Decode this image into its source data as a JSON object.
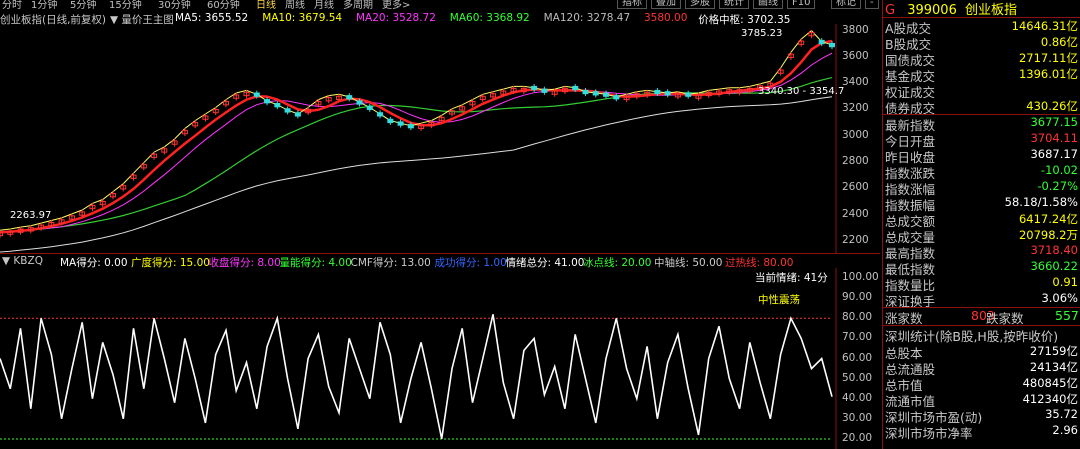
{
  "timeframe_tabs": [
    "分时",
    "1分钟",
    "5分钟",
    "15分钟",
    "30分钟",
    "60分钟",
    "日线",
    "周线",
    "月线",
    "多周期",
    "更多>"
  ],
  "selected_tab": "日线",
  "toolbar_buttons": [
    "指标",
    "叠加",
    "多股",
    "统计",
    "画线",
    "F10",
    "标记",
    "-",
    "回",
    "显"
  ],
  "ma_line": {
    "title": "创业板指(日线,前复权)",
    "subtitle": "▼ 量价王主图",
    "items": [
      {
        "label": "MA5: 3655.52",
        "color": "#ffffff"
      },
      {
        "label": "MA10: 3679.54",
        "color": "#ffff00"
      },
      {
        "label": "MA20: 3528.72",
        "color": "#ff33ff"
      },
      {
        "label": "MA60: 3368.92",
        "color": "#33ff33"
      },
      {
        "label": "MA120: 3278.47",
        "color": "#bbbbbb"
      },
      {
        "label": "3580.00",
        "color": "#ff3333"
      },
      {
        "label": "价格中枢: 3702.35",
        "color": "#ffffff"
      }
    ]
  },
  "price_axis": [
    "3800",
    "3600",
    "3400",
    "3200",
    "3000",
    "2800",
    "2600",
    "2400",
    "2200"
  ],
  "price_annotations": {
    "high": "3785.23",
    "low": "2263.97",
    "mid": "3340.30 - 3354.7"
  },
  "osc_line": {
    "name": "KBZQ",
    "items": [
      {
        "label": "MA得分: 0.00",
        "color": "#ffffff"
      },
      {
        "label": "广度得分: 15.00",
        "color": "#ffff00"
      },
      {
        "label": "收盘得分: 8.00",
        "color": "#ff33ff"
      },
      {
        "label": "量能得分: 4.00",
        "color": "#33ff33"
      },
      {
        "label": "CMF得分: 13.00",
        "color": "#cccccc"
      },
      {
        "label": "成功得分: 1.00",
        "color": "#3366ff"
      },
      {
        "label": "情绪总分: 41.00",
        "color": "#ffffff"
      },
      {
        "label": "冰点线: 20.00",
        "color": "#33ff33"
      },
      {
        "label": "中轴线: 50.00",
        "color": "#cccccc"
      },
      {
        "label": "过热线: 80.00",
        "color": "#ff3333"
      }
    ]
  },
  "osc_axis": [
    "100.00",
    "90.00",
    "80.00",
    "70.00",
    "60.00",
    "50.00",
    "40.00",
    "30.00",
    "20.00"
  ],
  "current_mood_label": "当前情绪: 41分",
  "mood_state": "中性震荡",
  "index_header": {
    "prefix": "G",
    "code": "399006",
    "name": "创业板指"
  },
  "turnover_rows": [
    {
      "k": "A股成交",
      "v": "14646.31亿",
      "c": "#ffff00"
    },
    {
      "k": "B股成交",
      "v": "0.86亿",
      "c": "#ffff00"
    },
    {
      "k": "国债成交",
      "v": "2717.11亿",
      "c": "#ffff00"
    },
    {
      "k": "基金成交",
      "v": "1396.01亿",
      "c": "#ffff00"
    },
    {
      "k": "权证成交",
      "v": "",
      "c": "#ffff00"
    },
    {
      "k": "债券成交",
      "v": "430.26亿",
      "c": "#ffff00"
    }
  ],
  "index_rows": [
    {
      "k": "最新指数",
      "v": "3677.15",
      "c": "#33ff33"
    },
    {
      "k": "今日开盘",
      "v": "3704.11",
      "c": "#ff3333"
    },
    {
      "k": "昨日收盘",
      "v": "3687.17",
      "c": "#ffffff"
    },
    {
      "k": "指数涨跌",
      "v": "-10.02",
      "c": "#33ff33"
    },
    {
      "k": "指数涨幅",
      "v": "-0.27%",
      "c": "#33ff33"
    },
    {
      "k": "指数振幅",
      "v": "58.18/1.58%",
      "c": "#ffffff"
    },
    {
      "k": "总成交额",
      "v": "6417.24亿",
      "c": "#ffff00"
    },
    {
      "k": "总成交量",
      "v": "20798.2万",
      "c": "#ffff00"
    },
    {
      "k": "最高指数",
      "v": "3718.40",
      "c": "#ff3333"
    },
    {
      "k": "最低指数",
      "v": "3660.22",
      "c": "#33ff33"
    },
    {
      "k": "指数量比",
      "v": "0.91",
      "c": "#ffff00"
    },
    {
      "k": "深证换手",
      "v": "3.06%",
      "c": "#ffffff"
    }
  ],
  "breadth": {
    "up_label": "涨家数",
    "up_value": "803",
    "down_label": "跌家数",
    "down_value": "557"
  },
  "stats_title": "深圳统计(除B股,H股,按昨收价)",
  "stats_rows": [
    {
      "k": "总股本",
      "v": "27159亿",
      "c": "#ffffff"
    },
    {
      "k": "总流通股",
      "v": "24134亿",
      "c": "#ffffff"
    },
    {
      "k": "总市值",
      "v": "480845亿",
      "c": "#ffffff"
    },
    {
      "k": "流通市值",
      "v": "412340亿",
      "c": "#ffffff"
    },
    {
      "k": "深圳市场市盈(动)",
      "v": "35.72",
      "c": "#ffffff"
    },
    {
      "k": "深圳市场市净率",
      "v": "2.96",
      "c": "#ffffff"
    }
  ],
  "chart_data": [
    {
      "type": "line",
      "ylim": [
        2100,
        3850
      ],
      "price_path": [
        2265,
        2275,
        2290,
        2300,
        2320,
        2340,
        2360,
        2390,
        2420,
        2470,
        2500,
        2560,
        2620,
        2700,
        2780,
        2860,
        2900,
        2960,
        3040,
        3100,
        3150,
        3200,
        3260,
        3310,
        3330,
        3300,
        3250,
        3220,
        3180,
        3150,
        3200,
        3260,
        3290,
        3300,
        3280,
        3240,
        3200,
        3150,
        3100,
        3080,
        3060,
        3080,
        3100,
        3140,
        3190,
        3220,
        3260,
        3300,
        3320,
        3340,
        3360,
        3360,
        3350,
        3330,
        3340,
        3360,
        3350,
        3320,
        3310,
        3300,
        3280,
        3300,
        3320,
        3330,
        3320,
        3310,
        3320,
        3300,
        3310,
        3330,
        3340,
        3350,
        3350,
        3360,
        3380,
        3400,
        3500,
        3620,
        3720,
        3785,
        3700,
        3677
      ]
    },
    {
      "type": "line",
      "ylim": [
        15,
        105
      ],
      "mood_path": [
        60,
        45,
        75,
        35,
        80,
        62,
        30,
        55,
        78,
        40,
        68,
        52,
        30,
        75,
        45,
        80,
        60,
        38,
        70,
        50,
        28,
        62,
        74,
        44,
        58,
        35,
        66,
        80,
        50,
        25,
        60,
        72,
        46,
        33,
        70,
        55,
        40,
        78,
        62,
        28,
        50,
        68,
        45,
        20,
        55,
        75,
        38,
        60,
        82,
        48,
        30,
        64,
        70,
        42,
        56,
        35,
        72,
        50,
        28,
        60,
        80,
        55,
        40,
        66,
        30,
        58,
        72,
        45,
        22,
        60,
        76,
        50,
        35,
        68,
        48,
        30,
        62,
        80,
        70,
        55,
        60,
        41
      ],
      "lines": {
        "overheat": 80,
        "middle": 50,
        "freeze": 20
      }
    }
  ]
}
